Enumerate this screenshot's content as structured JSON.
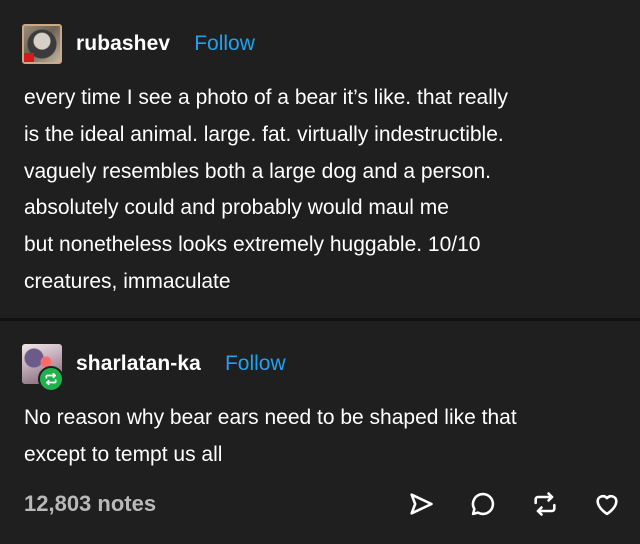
{
  "posts": [
    {
      "username": "rubashev",
      "follow_label": "Follow",
      "body_lines": [
        "every time I see a photo of a bear it’s like. that really",
        "is the ideal animal. large. fat. virtually indestructible.",
        "vaguely resembles both a large dog and a person.",
        "absolutely could and probably would maul me",
        "but nonetheless looks extremely huggable. 10/10",
        "creatures, immaculate"
      ]
    },
    {
      "username": "sharlatan-ka",
      "follow_label": "Follow",
      "body_lines": [
        "No reason why bear ears need to be shaped like that",
        "except to tempt us all"
      ]
    }
  ],
  "footer": {
    "notes": "12,803 notes",
    "actions": [
      "share-icon",
      "reply-icon",
      "reblog-icon",
      "like-icon"
    ]
  },
  "colors": {
    "background": "#1f1f1f",
    "text": "#ffffff",
    "follow_link": "#1fa2ee",
    "notes_text": "#b9b9b9",
    "reblog_badge": "#1fb24a"
  }
}
